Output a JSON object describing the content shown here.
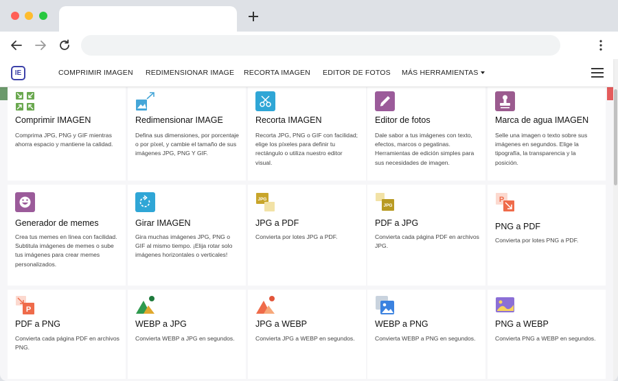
{
  "browser": {
    "new_tab_symbol": "+"
  },
  "site": {
    "logo_text": "IE",
    "nav": [
      {
        "label": "COMPRIMIR IMAGEN"
      },
      {
        "label": "REDIMENSIONAR IMAGE"
      },
      {
        "label": "RECORTA IMAGEN"
      },
      {
        "label": "EDITOR DE FOTOS"
      },
      {
        "label": "MÁS HERRAMIENTAS"
      }
    ]
  },
  "tools": [
    {
      "title": "Comprimir IMAGEN",
      "desc": "Comprima JPG, PNG y GIF mientras ahorra espacio y mantiene la calidad.",
      "icon": "compress-icon",
      "color": "#6aa84f"
    },
    {
      "title": "Redimensionar IMAGE",
      "desc": "Defina sus dimensiones, por porcentaje o por píxel, y cambie el tamaño de sus imágenes JPG, PNG Y GIF.",
      "icon": "resize-icon",
      "color": "#45a6d8"
    },
    {
      "title": "Recorta IMAGEN",
      "desc": "Recorta JPG, PNG o GIF con facilidad; elige los píxeles para definir tu rectángulo o utiliza nuestro editor visual.",
      "icon": "crop-icon",
      "color": "#2fa6d6"
    },
    {
      "title": "Editor de fotos",
      "desc": "Dale sabor a tus imágenes con texto, efectos, marcos o pegatinas. Herramientas de edición simples para sus necesidades de imagen.",
      "icon": "pencil-icon",
      "color": "#9b5b9a"
    },
    {
      "title": "Marca de agua IMAGEN",
      "desc": "Selle una imagen o texto sobre sus imágenes en segundos. Elige la tipografía, la transparencia y la posición.",
      "icon": "stamp-icon",
      "color": "#9b5b8f"
    },
    {
      "title": "Generador de memes",
      "desc": "Crea tus memes en línea con facilidad. Subtitula imágenes de memes o sube tus imágenes para crear memes personalizados.",
      "icon": "meme-face-icon",
      "color": "#9b5b9a"
    },
    {
      "title": "Girar IMAGEN",
      "desc": "Gira muchas imágenes JPG, PNG o GIF al mismo tiempo. ¡Elija rotar solo imágenes horizontales o verticales!",
      "icon": "rotate-icon",
      "color": "#2fa6d6"
    },
    {
      "title": "JPG a PDF",
      "desc": "Convierta por lotes JPG a PDF.",
      "icon": "jpg-to-pdf-icon",
      "color": "#c8a52a",
      "badge": "JPG"
    },
    {
      "title": "PDF a JPG",
      "desc": "Convierta cada página PDF en archivos JPG.",
      "icon": "pdf-to-jpg-icon",
      "color": "#b89a22",
      "badge": "JPG"
    },
    {
      "title": "PNG a PDF",
      "desc": "Convierta por lotes PNG a PDF.",
      "icon": "png-to-pdf-icon",
      "color": "#ef6b4a",
      "badge": "P"
    },
    {
      "title": "PDF a PNG",
      "desc": "Convierta cada página PDF en archivos PNG.",
      "icon": "pdf-to-png-icon",
      "color": "#ef6b4a",
      "badge": "P"
    },
    {
      "title": "WEBP a JPG",
      "desc": "Convierta WEBP a JPG en segundos.",
      "icon": "webp-to-jpg-icon",
      "color": "#2f9a4e"
    },
    {
      "title": "JPG a WEBP",
      "desc": "Convierta JPG a WEBP en segundos.",
      "icon": "jpg-to-webp-icon",
      "color": "#ef6b4a"
    },
    {
      "title": "WEBP a PNG",
      "desc": "Convierta WEBP a PNG en segundos.",
      "icon": "webp-to-png-icon",
      "color": "#3b82e0"
    },
    {
      "title": "PNG a WEBP",
      "desc": "Convierta PNG a WEBP en segundos.",
      "icon": "png-to-webp-icon",
      "color": "#8b6fd6"
    }
  ]
}
